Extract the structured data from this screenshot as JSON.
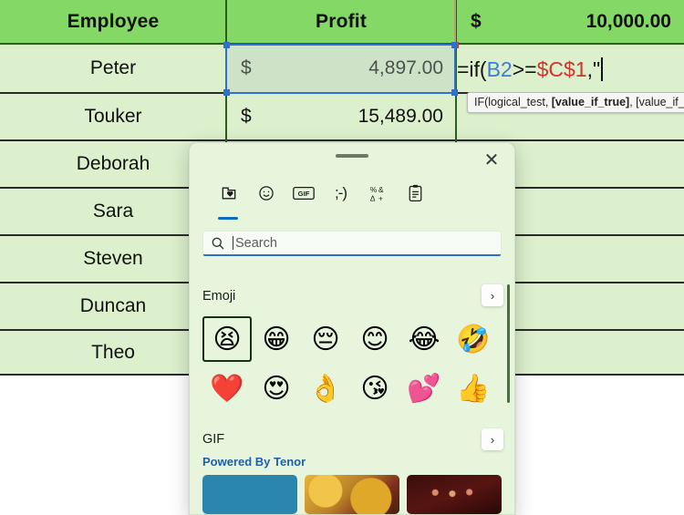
{
  "spreadsheet": {
    "headers": {
      "employee": "Employee",
      "profit": "Profit",
      "threshold_symbol": "$",
      "threshold_value": "10,000.00"
    },
    "rows": [
      {
        "name": "Peter",
        "currency": "$",
        "profit": "4,897.00"
      },
      {
        "name": "Touker",
        "currency": "$",
        "profit": "15,489.00"
      },
      {
        "name": "Deborah",
        "currency": "$",
        "profit": ""
      },
      {
        "name": "Sara",
        "currency": "$",
        "profit": ""
      },
      {
        "name": "Steven",
        "currency": "$",
        "profit": ""
      },
      {
        "name": "Duncan",
        "currency": "$",
        "profit": ""
      },
      {
        "name": "Theo",
        "currency": "$",
        "profit": ""
      }
    ],
    "formula": {
      "prefix": "=if(",
      "ref_relative": "B2",
      "operator": ">=",
      "ref_absolute": "$C$1",
      "suffix": ",\""
    },
    "tooltip": {
      "fn": "IF(",
      "arg1": "logical_test, ",
      "arg2": "[value_if_true]",
      "arg3": ", [value_if_fals"
    },
    "colors": {
      "header_green": "#84d966",
      "cell_green": "#dcf0cd",
      "selection_blue": "#2f6fd0",
      "reference_red": "#d0342c",
      "reference_blue": "#3b7ddd",
      "grid_dark": "#2b2b2b"
    }
  },
  "emoji_panel": {
    "close_label": "✕",
    "tabs": [
      {
        "name": "recent",
        "glyph": "recent-heart-icon",
        "active": true
      },
      {
        "name": "emoji",
        "glyph": "smiley-icon",
        "active": false
      },
      {
        "name": "gif",
        "glyph": "gif-icon",
        "label": "GIF",
        "active": false
      },
      {
        "name": "kaomoji",
        "glyph": "kaomoji-icon",
        "label": ";-)",
        "active": false
      },
      {
        "name": "symbols",
        "glyph": "symbols-icon",
        "active": false
      },
      {
        "name": "clipboard",
        "glyph": "clipboard-icon",
        "active": false
      }
    ],
    "search": {
      "placeholder": "Search",
      "value": ""
    },
    "sections": {
      "emoji": {
        "title": "Emoji",
        "more": "›"
      },
      "gif": {
        "title": "GIF",
        "more": "›",
        "attribution": "Powered By Tenor"
      }
    },
    "emoji_rows": [
      [
        "😫",
        "😁",
        "😔",
        "😊",
        "😂",
        "🤣"
      ],
      [
        "❤️",
        "😍",
        "👌",
        "😘",
        "💕",
        "👍"
      ]
    ],
    "selected_emoji_index": 0,
    "gif_thumbnails": [
      "gif-thumbnail-blue",
      "gif-thumbnail-minions",
      "gif-thumbnail-dark"
    ]
  }
}
